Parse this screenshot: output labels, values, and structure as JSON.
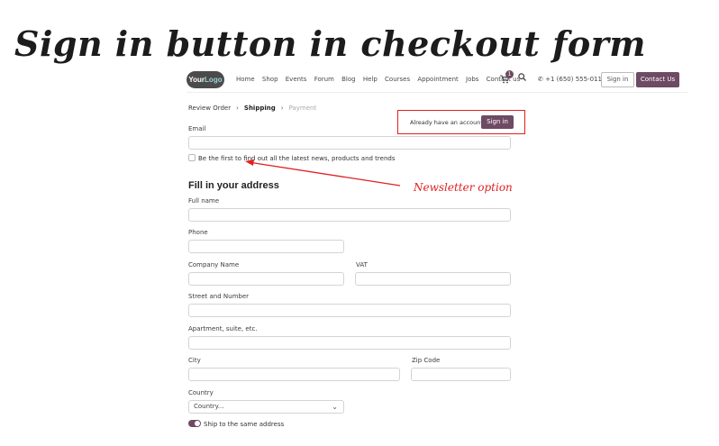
{
  "title": "Sign in button in checkout form",
  "navbar": {
    "logo_part1": "Your",
    "logo_part2": "Logo",
    "links": [
      "Home",
      "Shop",
      "Events",
      "Forum",
      "Blog",
      "Help",
      "Courses",
      "Appointment",
      "Jobs",
      "Contact us"
    ],
    "cart_count": "1",
    "phone": "+1 (650) 555-0111",
    "sign_in_label": "Sign in",
    "contact_label": "Contact Us"
  },
  "breadcrumb": {
    "step1": "Review Order",
    "step2": "Shipping",
    "step3": "Payment"
  },
  "form": {
    "email_label": "Email",
    "account_prompt": "Already have an account?",
    "sign_in_button": "Sign in",
    "newsletter_label": "Be the first to find out all the latest news, products and trends",
    "section_title": "Fill in your address",
    "full_name_label": "Full name",
    "phone_label": "Phone",
    "company_label": "Company Name",
    "vat_label": "VAT",
    "street_label": "Street and Number",
    "apartment_label": "Apartment, suite, etc.",
    "city_label": "City",
    "zip_label": "Zip Code",
    "country_label": "Country",
    "country_value": "Country...",
    "ship_same_label": "Ship to the same address"
  },
  "annotation": {
    "text": "Newsletter option",
    "color": "#e02020"
  },
  "colors": {
    "brand": "#6e4a63",
    "highlight": "#e02020"
  }
}
